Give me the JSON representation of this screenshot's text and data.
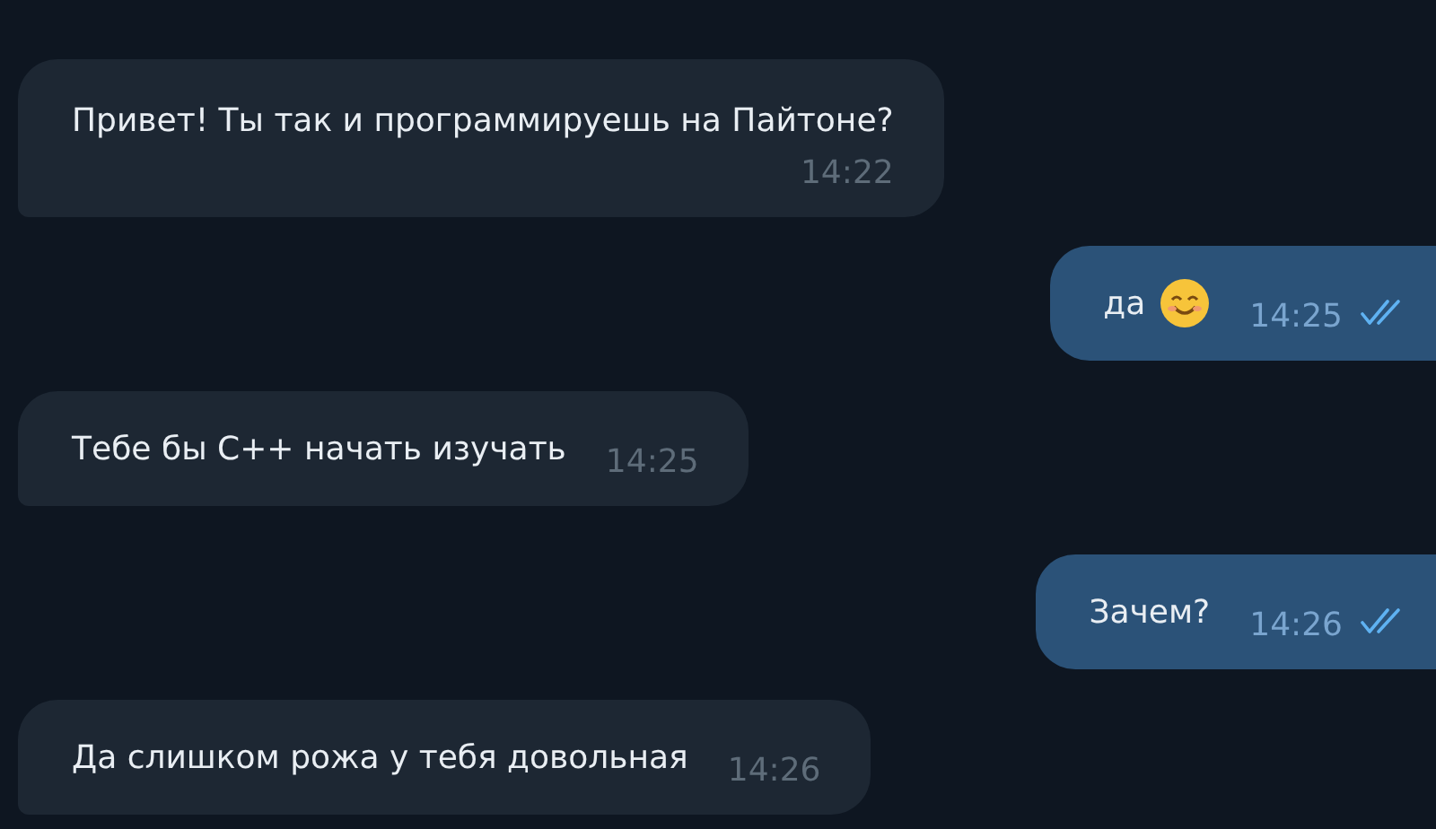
{
  "messages": [
    {
      "text": "Привет! Ты так и программируешь на Пайтоне?",
      "time": "14:22",
      "outgoing": false,
      "kind": "stacked"
    },
    {
      "text": "да",
      "time": "14:25",
      "outgoing": true,
      "kind": "inline",
      "emoji": true,
      "read": true
    },
    {
      "text": "Тебе бы C++ начать изучать",
      "time": "14:25",
      "outgoing": false,
      "kind": "inline"
    },
    {
      "text": "Зачем?",
      "time": "14:26",
      "outgoing": true,
      "kind": "inline",
      "read": true
    },
    {
      "text": "Да слишком рожа у тебя довольная",
      "time": "14:26",
      "outgoing": false,
      "kind": "inline"
    }
  ]
}
